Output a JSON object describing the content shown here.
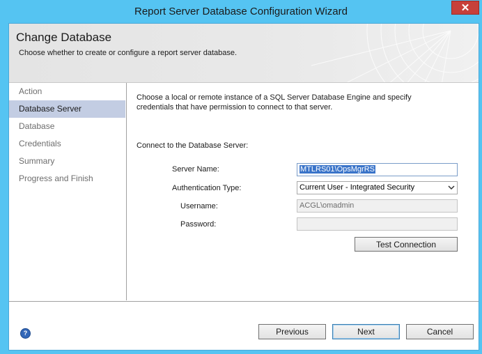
{
  "window": {
    "title": "Report Server Database Configuration Wizard",
    "close_glyph": "✕"
  },
  "header": {
    "title": "Change Database",
    "subtitle": "Choose whether to create or configure a report server database."
  },
  "nav": {
    "items": [
      {
        "label": "Action",
        "active": false
      },
      {
        "label": "Database Server",
        "active": true
      },
      {
        "label": "Database",
        "active": false
      },
      {
        "label": "Credentials",
        "active": false
      },
      {
        "label": "Summary",
        "active": false
      },
      {
        "label": "Progress and Finish",
        "active": false
      }
    ]
  },
  "content": {
    "intro": "Choose a local or remote instance of a SQL Server Database Engine and specify credentials that have permission to connect to that server.",
    "section_label": "Connect to the Database Server:",
    "server_name_label": "Server Name:",
    "server_name_value": "MTLRS01\\OpsMgrRS",
    "auth_type_label": "Authentication Type:",
    "auth_type_value": "Current User - Integrated Security",
    "username_label": "Username:",
    "username_value": "ACGL\\omadmin",
    "password_label": "Password:",
    "password_value": "",
    "test_connection_label": "Test Connection"
  },
  "footer": {
    "help_glyph": "?",
    "previous_label": "Previous",
    "next_label": "Next",
    "cancel_label": "Cancel"
  },
  "colors": {
    "titlebar": "#55c4f2",
    "close_button": "#c7403a",
    "nav_active": "#c3cde3",
    "selection": "#3a74c9"
  },
  "icons": {
    "close": "close-icon",
    "help": "help-icon",
    "dropdown": "chevron-down-icon"
  }
}
